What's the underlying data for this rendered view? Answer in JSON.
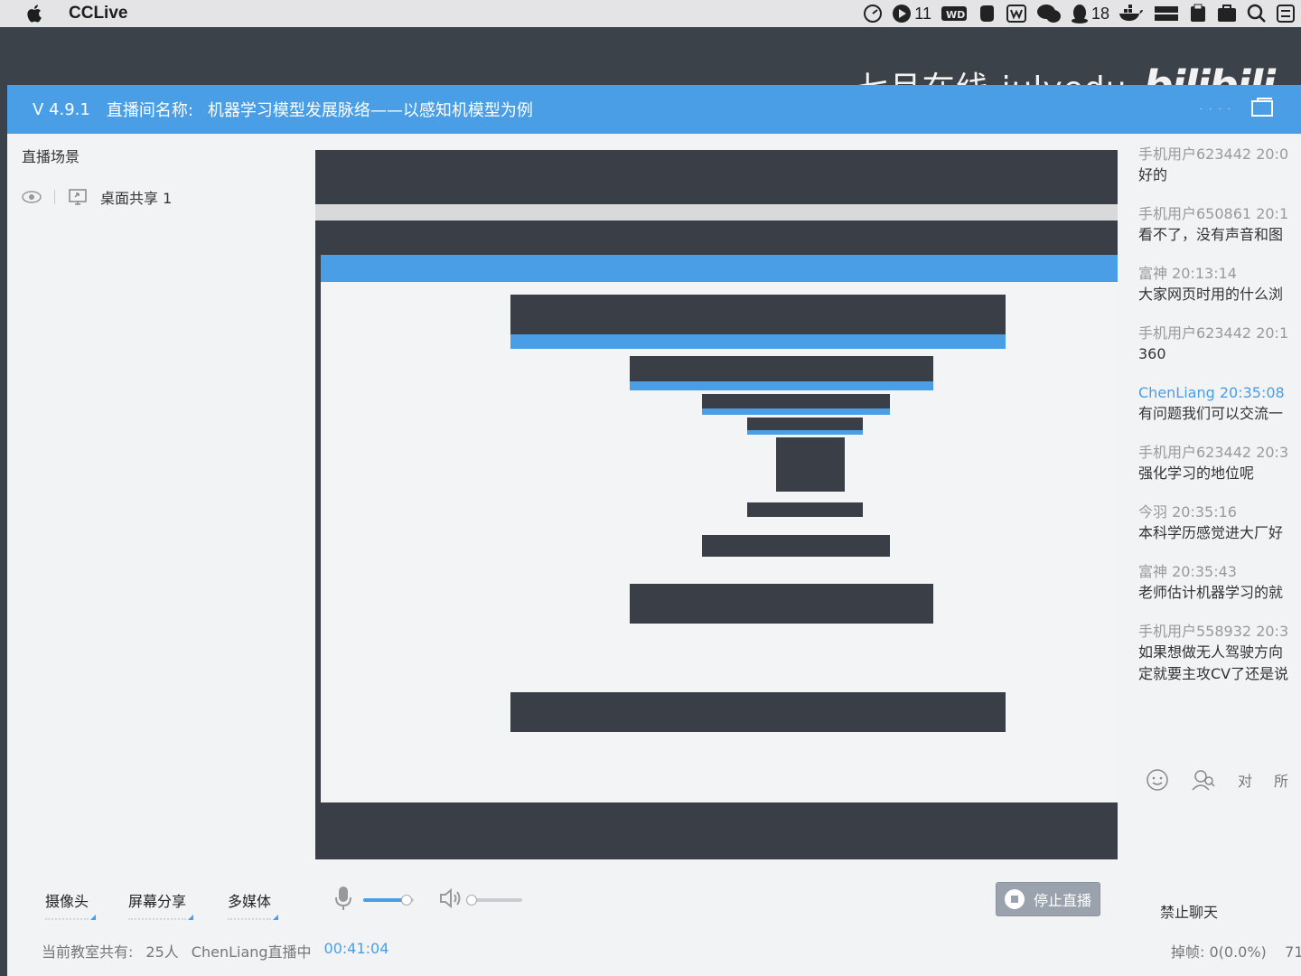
{
  "menubar": {
    "app_name": "CCLive",
    "badge_video": "11",
    "badge_qq": "18"
  },
  "watermark": {
    "text": "七月在线-julyedu",
    "logo": "bilibili"
  },
  "window": {
    "version": "V 4.9.1",
    "room_label": "直播间名称:",
    "room_name": "机器学习模型发展脉络——以感知机模型为例"
  },
  "left_panel": {
    "scene_label": "直播场景",
    "scene_item": "桌面共享 1"
  },
  "chat": {
    "messages": [
      {
        "user": "手机用户623442",
        "time": "20:0",
        "text": "好的",
        "teacher": false
      },
      {
        "user": "手机用户650861",
        "time": "20:1",
        "text": "看不了，没有声音和图",
        "teacher": false
      },
      {
        "user": "富神",
        "time": "20:13:14",
        "text": "大家网页时用的什么浏",
        "teacher": false
      },
      {
        "user": "手机用户623442",
        "time": "20:1",
        "text": "360",
        "teacher": false
      },
      {
        "user": "ChenLiang",
        "time": "20:35:08",
        "text": "有问题我们可以交流一",
        "teacher": true
      },
      {
        "user": "手机用户623442",
        "time": "20:3",
        "text": "强化学习的地位呢",
        "teacher": false
      },
      {
        "user": "今羽",
        "time": "20:35:16",
        "text": "本科学历感觉进大厂好",
        "teacher": false
      },
      {
        "user": "富神",
        "time": "20:35:43",
        "text": "老师估计机器学习的就",
        "teacher": false
      },
      {
        "user": "手机用户558932",
        "time": "20:3",
        "text": "如果想做无人驾驶方向",
        "text2": "定就要主攻CV了还是说",
        "teacher": false
      }
    ],
    "tools": {
      "to_label": "对",
      "all_label": "所"
    }
  },
  "toolbar": {
    "camera": "摄像头",
    "screen_share": "屏幕分享",
    "multimedia": "多媒体",
    "mic_level": 0.85,
    "speaker_level": 0.0,
    "stop_live": "停止直播",
    "ban_chat": "禁止聊天"
  },
  "status": {
    "audience_label": "当前教室共有:",
    "audience_count": "25人",
    "host_status": "ChenLiang直播中",
    "timer": "00:41:04",
    "dropped_frames": "掉帧: 0(0.0%)",
    "extra": "71"
  },
  "colors": {
    "accent": "#4a9ee6",
    "desktop": "#3c4249"
  }
}
